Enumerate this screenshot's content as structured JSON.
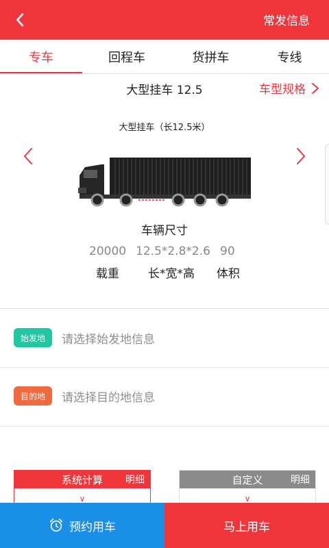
{
  "header": {
    "right_label": "常发信息"
  },
  "tabs": [
    {
      "label": "专车"
    },
    {
      "label": "回程车"
    },
    {
      "label": "货拼车"
    },
    {
      "label": "专线"
    }
  ],
  "vehicle": {
    "name": "大型挂车 12.5",
    "spec_link": "车型规格",
    "caption": "大型挂车（长12.5米）",
    "dimension_title": "车辆尺寸",
    "specs": [
      {
        "value": "20000",
        "label": "载重"
      },
      {
        "value": "12.5*2.8*2.6",
        "label": "长*宽*高"
      },
      {
        "value": "90",
        "label": "体积"
      }
    ]
  },
  "locations": {
    "origin": {
      "badge": "始发地",
      "placeholder": "请选择始发地信息"
    },
    "destination": {
      "badge": "目的地",
      "placeholder": "请选择目的地信息"
    }
  },
  "pricing": {
    "system": {
      "title": "系统计算",
      "detail": "明细"
    },
    "custom": {
      "title": "自定义",
      "detail": "明细"
    }
  },
  "bottom": {
    "reserve_label": "预约用车",
    "now_label": "马上用车"
  },
  "colors": {
    "primary": "#f0363b",
    "blue": "#198fe8",
    "green": "#1fc7a2",
    "orange": "#f06a3e"
  }
}
